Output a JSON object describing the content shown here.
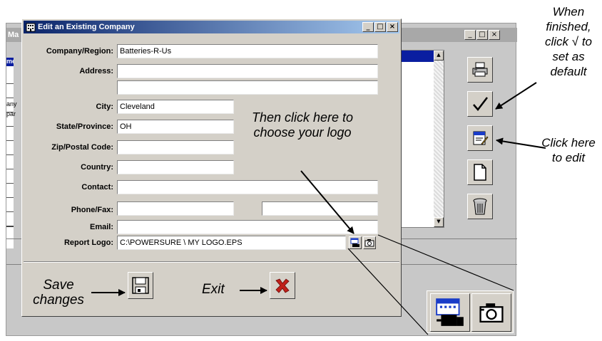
{
  "background_window": {
    "title_fragment": "Ma",
    "list_header_fragment": "me",
    "row_fragments": [
      "any",
      "par"
    ],
    "sys_buttons": [
      "_",
      "□",
      "×"
    ]
  },
  "dialog": {
    "title": "Edit an Existing Company",
    "sys_buttons": [
      "_",
      "□",
      "×"
    ],
    "fields": {
      "company_region": {
        "label": "Company/Region:",
        "value": "Batteries-R-Us"
      },
      "address": {
        "label": "Address:",
        "value": "",
        "value2": ""
      },
      "city": {
        "label": "City:",
        "value": "Cleveland"
      },
      "state_province": {
        "label": "State/Province:",
        "value": "OH"
      },
      "zip_postal": {
        "label": "Zip/Postal Code:",
        "value": ""
      },
      "country": {
        "label": "Country:",
        "value": ""
      },
      "contact": {
        "label": "Contact:",
        "value": ""
      },
      "phone_fax": {
        "label": "Phone/Fax:",
        "phone": "",
        "fax": ""
      },
      "email": {
        "label": "Email:",
        "value": ""
      },
      "report_logo": {
        "label": "Report Logo:",
        "value": "C:\\POWERSURE \\ MY LOGO.EPS"
      }
    }
  },
  "annotations": {
    "when_finished": "When finished, click √ to set as default",
    "click_to_edit": "Click here to edit",
    "choose_logo": "Then click here to choose your logo",
    "save_changes": "Save changes",
    "exit": "Exit"
  },
  "icons": {
    "print": "printer-icon",
    "set_default": "checkmark-icon",
    "edit": "edit-notepad-icon",
    "new": "new-document-icon",
    "delete": "trash-can-icon",
    "browse_logo": "browse-folder-icon",
    "camera": "camera-icon",
    "save": "floppy-disk-icon",
    "exit": "red-x-icon"
  },
  "colors": {
    "title_bar": "#0a246a",
    "list_highlight": "#0a1ea0",
    "exit_x": "#c0201a"
  }
}
